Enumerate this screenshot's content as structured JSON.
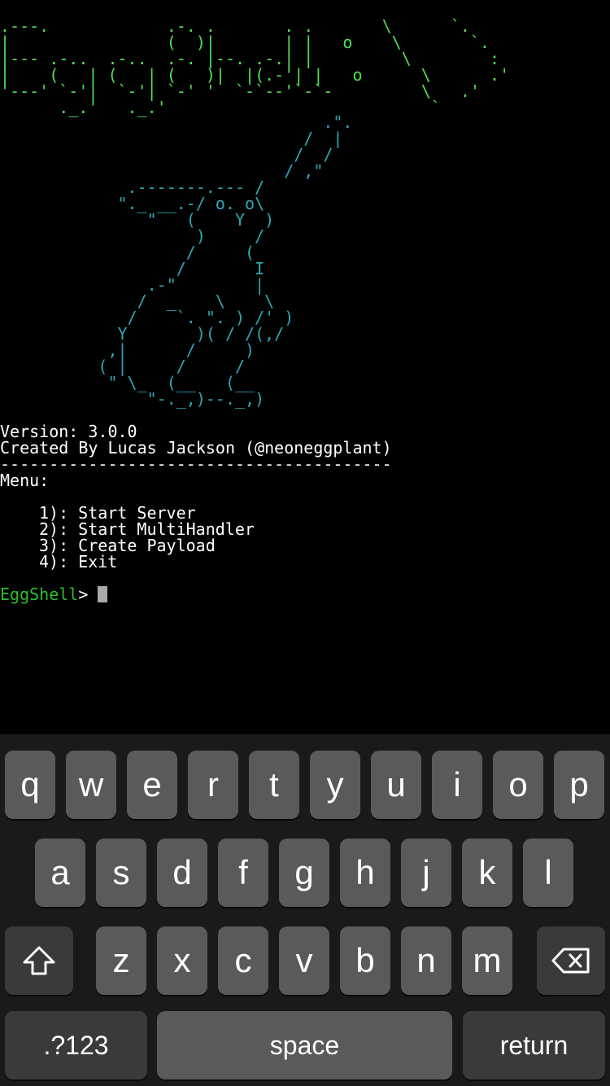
{
  "terminal": {
    "banner_logo": ".---.            .-. .       . .       \\      `.\n|                (  )|       | |   o    \\       `.\n|--- .-..  .-..  .-. |--. .-.| |         \\        :\n|    (   | (   | (   )|  |(.-'| |   o      \\      .'\n'---' `-'|  `-'| `-' '  `-`--'`-`-         \\   .'\n      ._.'   ._.'                           `",
    "banner_art": "                                 .\".\n                               /  |\n                              /  /\n                             / ,\"\n             .-------.--- /\n            \"._ __.-/ o. o\\\n               \"   (    Y  )\n                    )     /\n                   /     (\n                  /       I\n               .-\"        |\n              /  _    \\    \\\n             /    `. \". ) /' )\n            Y       )( / /(,/\n           ,|      /     )\n          ( |     /     /\n           \" \\_  (__   (__\n               \"-._,)--._,)",
    "version_line": "Version: 3.0.0",
    "created_by_line": "Created By Lucas Jackson (@neoneggplant)",
    "divider": "----------------------------------------",
    "menu_label": "Menu:",
    "menu_items": [
      "1): Start Server",
      "2): Start MultiHandler",
      "3): Create Payload",
      "4): Exit"
    ],
    "prompt_label": "EggShell",
    "prompt_symbol": ">"
  },
  "keyboard": {
    "row1": [
      "q",
      "w",
      "e",
      "r",
      "t",
      "y",
      "u",
      "i",
      "o",
      "p"
    ],
    "row2": [
      "a",
      "s",
      "d",
      "f",
      "g",
      "h",
      "j",
      "k",
      "l"
    ],
    "row3": [
      "z",
      "x",
      "c",
      "v",
      "b",
      "n",
      "m"
    ],
    "numbers_key": ".?123",
    "space_key": "space",
    "return_key": "return",
    "shift_icon": "shift-arrow-icon",
    "delete_icon": "backspace-icon"
  },
  "colors": {
    "background": "#000000",
    "logo_green": "#4fe24f",
    "art_cyan": "#2aa8b8",
    "prompt_green": "#2bbd2b",
    "key_light": "#5a5a5a",
    "key_dark": "#3a3a3a"
  }
}
